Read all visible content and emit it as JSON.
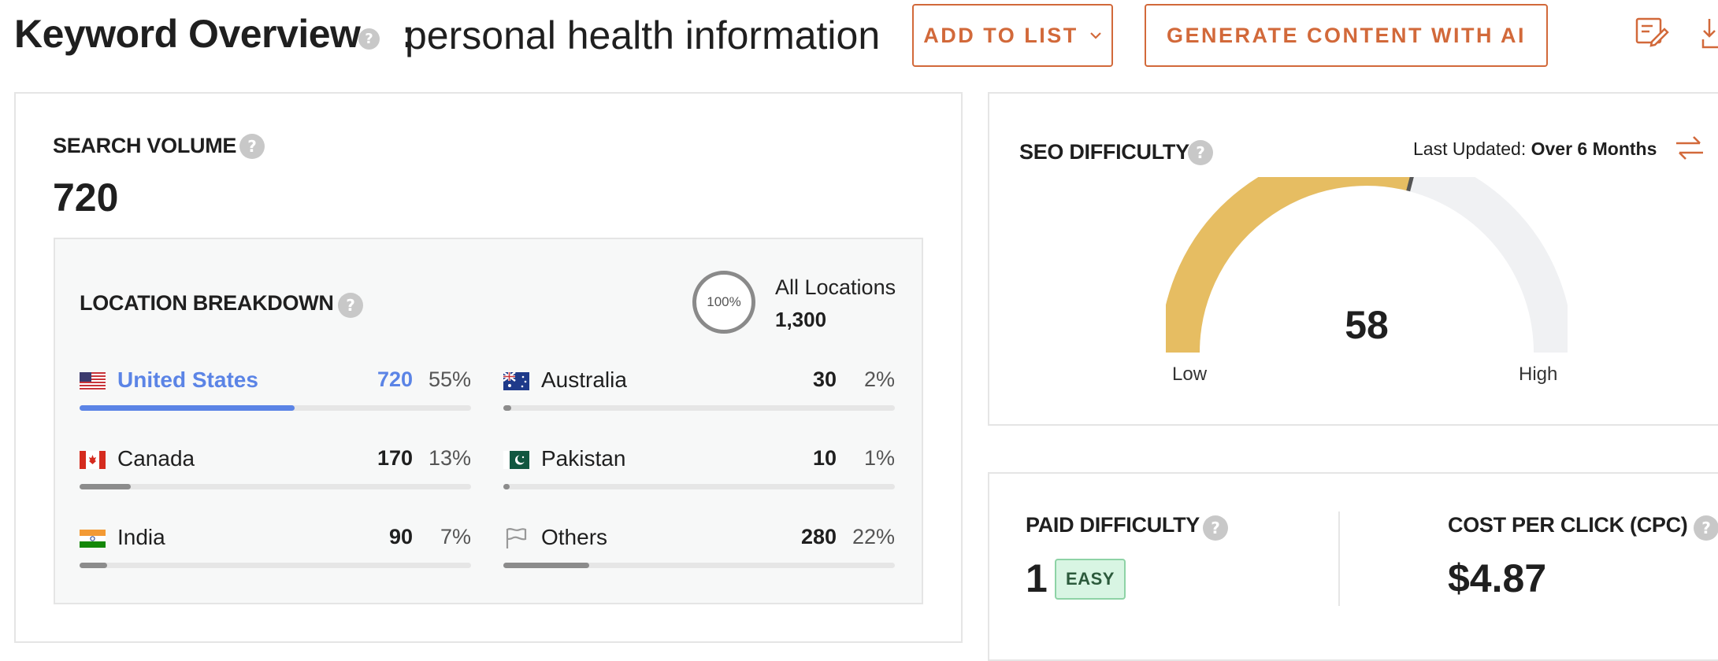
{
  "header": {
    "title": "Keyword Overview",
    "colon": ":",
    "keyword": "personal health information",
    "add_to_list_label": "ADD TO LIST",
    "generate_label": "GENERATE CONTENT WITH AI",
    "accent_color": "#d2693a"
  },
  "search_volume": {
    "label": "SEARCH VOLUME",
    "value": "720"
  },
  "location_breakdown": {
    "label": "LOCATION BREAKDOWN",
    "all_locations_percent": "100%",
    "all_locations_label": "All Locations",
    "all_locations_value": "1,300",
    "rows": [
      {
        "flag": "us-flag-icon",
        "name": "United States",
        "volume": "720",
        "percent": "55%",
        "share": 0.55,
        "active": true
      },
      {
        "flag": "au-flag-icon",
        "name": "Australia",
        "volume": "30",
        "percent": "2%",
        "share": 0.02,
        "active": false
      },
      {
        "flag": "ca-flag-icon",
        "name": "Canada",
        "volume": "170",
        "percent": "13%",
        "share": 0.13,
        "active": false
      },
      {
        "flag": "pk-flag-icon",
        "name": "Pakistan",
        "volume": "10",
        "percent": "1%",
        "share": 0.01,
        "active": false
      },
      {
        "flag": "in-flag-icon",
        "name": "India",
        "volume": "90",
        "percent": "7%",
        "share": 0.07,
        "active": false
      },
      {
        "flag": "others-flag-icon",
        "name": "Others",
        "volume": "280",
        "percent": "22%",
        "share": 0.22,
        "active": false
      }
    ]
  },
  "seo_difficulty": {
    "label": "SEO DIFFICULTY",
    "last_updated_label": "Last Updated:",
    "last_updated_value": "Over 6 Months",
    "value": "58",
    "score": 58,
    "low_label": "Low",
    "high_label": "High",
    "gauge_color": "#e6bd62"
  },
  "paid_difficulty": {
    "label": "PAID DIFFICULTY",
    "value": "1",
    "badge": "EASY"
  },
  "cpc": {
    "label": "COST PER CLICK (CPC)",
    "value": "$4.87"
  }
}
